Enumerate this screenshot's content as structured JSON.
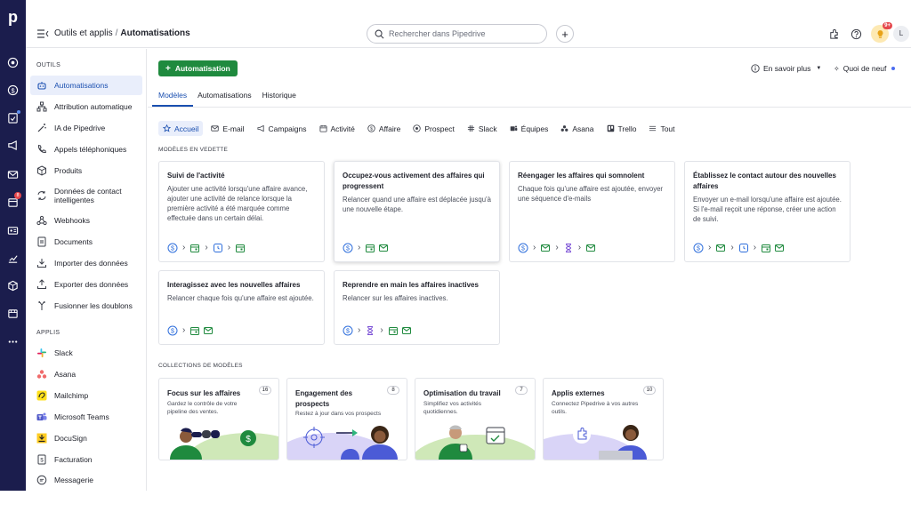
{
  "app": {
    "logo": "p"
  },
  "breadcrumb": {
    "parent": "Outils et applis",
    "separator": "/",
    "current": "Automatisations"
  },
  "search": {
    "placeholder": "Rechercher dans Pipedrive"
  },
  "topbar": {
    "notifications_badge": "9+",
    "avatar_initial": "L"
  },
  "rail": {
    "badge": "8"
  },
  "nav": {
    "tools_title": "OUTILS",
    "tools": [
      {
        "label": "Automatisations",
        "icon": "robot-icon"
      },
      {
        "label": "Attribution automatique",
        "icon": "org-chart-icon"
      },
      {
        "label": "IA de Pipedrive",
        "icon": "magic-wand-icon"
      },
      {
        "label": "Appels téléphoniques",
        "icon": "phone-icon"
      },
      {
        "label": "Produits",
        "icon": "box-icon"
      },
      {
        "label": "Données de contact intelligentes",
        "icon": "sync-icon"
      },
      {
        "label": "Webhooks",
        "icon": "webhook-icon"
      },
      {
        "label": "Documents",
        "icon": "document-icon"
      },
      {
        "label": "Importer des données",
        "icon": "import-icon"
      },
      {
        "label": "Exporter des données",
        "icon": "export-icon"
      },
      {
        "label": "Fusionner les doublons",
        "icon": "merge-icon"
      }
    ],
    "apps_title": "APPLIS",
    "apps": [
      {
        "label": "Slack",
        "icon": "slack-icon"
      },
      {
        "label": "Asana",
        "icon": "asana-icon"
      },
      {
        "label": "Mailchimp",
        "icon": "mailchimp-icon"
      },
      {
        "label": "Microsoft Teams",
        "icon": "teams-icon"
      },
      {
        "label": "DocuSign",
        "icon": "docusign-icon"
      },
      {
        "label": "Facturation",
        "icon": "invoice-icon"
      },
      {
        "label": "Messagerie",
        "icon": "chat-icon"
      }
    ]
  },
  "main": {
    "new_automation": "Automatisation",
    "learn_more": "En savoir plus",
    "whats_new": "Quoi de neuf",
    "tabs": [
      "Modèles",
      "Automatisations",
      "Historique"
    ],
    "filters": [
      "Accueil",
      "E-mail",
      "Campaigns",
      "Activité",
      "Affaire",
      "Prospect",
      "Slack",
      "Équipes",
      "Asana",
      "Trello",
      "Tout"
    ],
    "featured_title": "MODÈLES EN VEDETTE",
    "featured": [
      {
        "title": "Suivi de l'activité",
        "desc": "Ajouter une activité lorsqu'une affaire avance, ajouter une activité de relance lorsque la première activité a été marquée comme effectuée dans un certain délai.",
        "flow": [
          "dollar",
          "calendar",
          "clock",
          "calendar"
        ]
      },
      {
        "title": "Occupez-vous activement des affaires qui progressent",
        "desc": "Relancer quand une affaire est déplacée jusqu'à une nouvelle étape.",
        "flow": [
          "dollar",
          "calendar+mail"
        ]
      },
      {
        "title": "Réengager les affaires qui somnolent",
        "desc": "Chaque fois qu'une affaire est ajoutée, envoyer une séquence d'e-mails",
        "flow": [
          "dollar",
          "mail",
          "hourglass",
          "mail"
        ]
      },
      {
        "title": "Établissez le contact autour des nouvelles affaires",
        "desc": "Envoyer un e-mail lorsqu'une affaire est ajoutée. Si l'e-mail reçoit une réponse, créer une action de suivi.",
        "flow": [
          "dollar",
          "mail",
          "clock",
          "calendar+mail"
        ]
      },
      {
        "title": "Interagissez avec les nouvelles affaires",
        "desc": "Relancer chaque fois qu'une affaire est ajoutée.",
        "flow": [
          "dollar",
          "calendar+mail"
        ]
      },
      {
        "title": "Reprendre en main les affaires inactives",
        "desc": "Relancer sur les affaires inactives.",
        "flow": [
          "dollar",
          "hourglass",
          "calendar+mail"
        ]
      }
    ],
    "collections_title": "COLLECTIONS DE MODÈLES",
    "collections": [
      {
        "title": "Focus sur les affaires",
        "count": "16",
        "desc": "Gardez le contrôle de votre pipeline des ventes."
      },
      {
        "title": "Engagement des prospects",
        "count": "8",
        "desc": "Restez à jour dans vos prospects"
      },
      {
        "title": "Optimisation du travail",
        "count": "7",
        "desc": "Simplifiez vos activités quotidiennes."
      },
      {
        "title": "Applis externes",
        "count": "10",
        "desc": "Connectez Pipedrive à vos autres outils."
      }
    ]
  },
  "colors": {
    "rail": "#1b1d4d",
    "primary_green": "#1f8a3e",
    "accent_blue": "#1a4fb0",
    "flow_blue": "#2f6fdc",
    "flow_green": "#1f8a3e",
    "flow_purple": "#7a4fd6"
  }
}
